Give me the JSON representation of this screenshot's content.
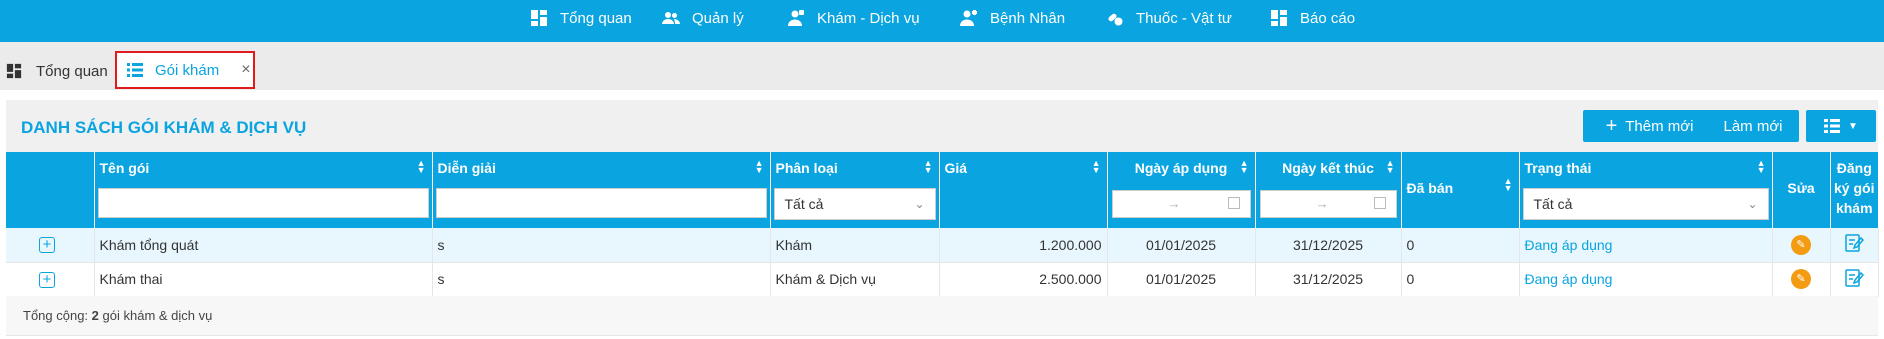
{
  "nav": [
    {
      "label": "Tổng quan",
      "icon": "dashboard-icon"
    },
    {
      "label": "Quản lý",
      "icon": "users-icon"
    },
    {
      "label": "Khám - Dịch vụ",
      "icon": "doctor-icon"
    },
    {
      "label": "Bệnh Nhân",
      "icon": "patient-icon"
    },
    {
      "label": "Thuốc - Vật tư",
      "icon": "pills-icon"
    },
    {
      "label": "Báo cáo",
      "icon": "report-icon"
    }
  ],
  "tabs": {
    "overview": "Tổng quan",
    "active": "Gói khám",
    "close": "×"
  },
  "panel": {
    "title": "DANH SÁCH GÓI KHÁM & DỊCH VỤ",
    "add_label": "Thêm mới",
    "refresh_label": "Làm mới"
  },
  "columns": {
    "name": "Tên gói",
    "desc": "Diễn giải",
    "category": "Phân loại",
    "price": "Giá",
    "start": "Ngày áp dụng",
    "end": "Ngày kết thúc",
    "sold": "Đã bán",
    "status": "Trạng thái",
    "edit": "Sửa",
    "register_1": "Đăng",
    "register_2": "ký gói",
    "register_3": "khám"
  },
  "filters": {
    "category_value": "Tất cả",
    "status_value": "Tất cả",
    "date_arrow": "→"
  },
  "rows": [
    {
      "name": "Khám tổng quát",
      "desc": "s",
      "category": "Khám",
      "price": "1.200.000",
      "start": "01/01/2025",
      "end": "31/12/2025",
      "sold": "0",
      "status": "Đang áp dụng"
    },
    {
      "name": "Khám thai",
      "desc": "s",
      "category": "Khám & Dịch vụ",
      "price": "2.500.000",
      "start": "01/01/2025",
      "end": "31/12/2025",
      "sold": "0",
      "status": "Đang áp dụng"
    }
  ],
  "footer": {
    "prefix": "Tổng cộng:",
    "count": "2",
    "suffix": "gói khám & dịch vụ"
  },
  "colors": {
    "primary": "#0aa4e0",
    "highlight_border": "#e01b1b",
    "edit_button": "#f39c12"
  }
}
